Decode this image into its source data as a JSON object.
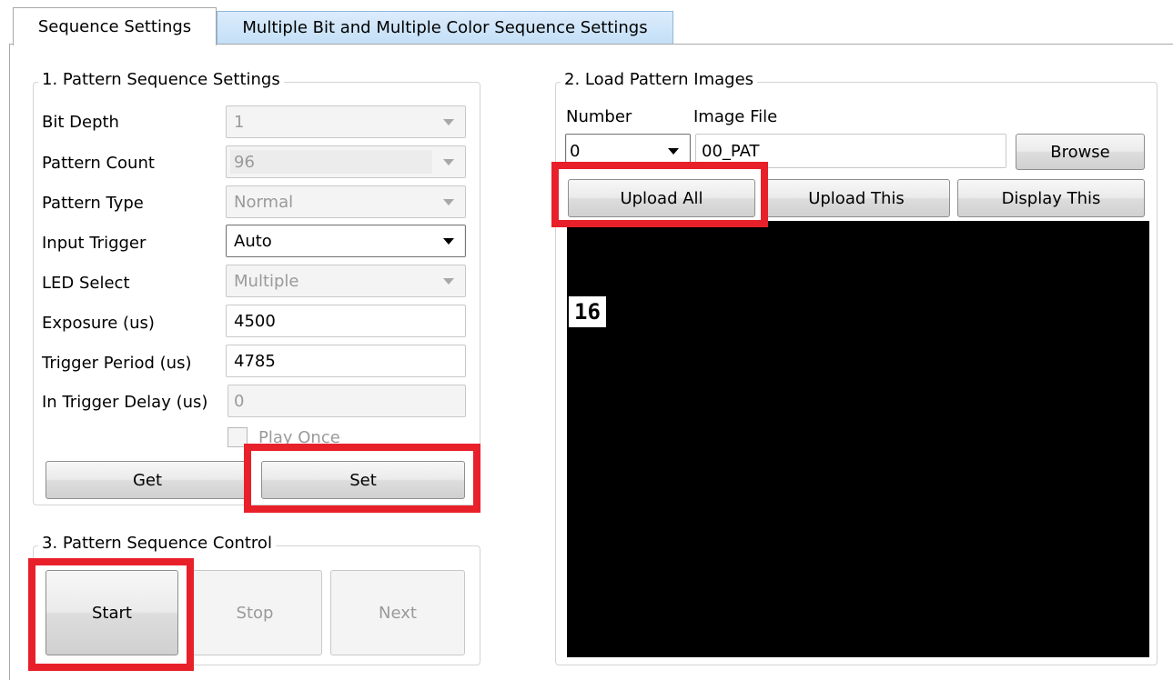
{
  "tabs": [
    {
      "label": "Sequence Settings",
      "active": true
    },
    {
      "label": "Multiple Bit and Multiple Color Sequence Settings",
      "active": false
    }
  ],
  "pattern_settings": {
    "title": "1. Pattern Sequence Settings",
    "bit_depth": {
      "label": "Bit Depth",
      "value": "1"
    },
    "pattern_count": {
      "label": "Pattern Count",
      "value": "96"
    },
    "pattern_type": {
      "label": "Pattern Type",
      "value": "Normal"
    },
    "input_trigger": {
      "label": "Input Trigger",
      "value": "Auto"
    },
    "led_select": {
      "label": "LED Select",
      "value": "Multiple"
    },
    "exposure": {
      "label": "Exposure (us)",
      "value": "4500"
    },
    "trigger_period": {
      "label": "Trigger Period (us)",
      "value": "4785"
    },
    "in_trigger_delay": {
      "label": "In Trigger Delay (us)",
      "value": "0"
    },
    "play_once": {
      "label": "Play Once",
      "checked": false
    },
    "get_label": "Get",
    "set_label": "Set"
  },
  "load_images": {
    "title": "2. Load Pattern Images",
    "number_label": "Number",
    "image_file_label": "Image File",
    "number_value": "0",
    "image_file_value": "00_PAT",
    "browse_label": "Browse",
    "upload_all_label": "Upload All",
    "upload_this_label": "Upload This",
    "display_this_label": "Display This",
    "preview_overlay": "16"
  },
  "control": {
    "title": "3. Pattern Sequence Control",
    "start_label": "Start",
    "stop_label": "Stop",
    "next_label": "Next"
  },
  "colors": {
    "highlight": "#e8202a",
    "tab_inactive": "#c3dff7",
    "preview_bg": "#000000"
  }
}
